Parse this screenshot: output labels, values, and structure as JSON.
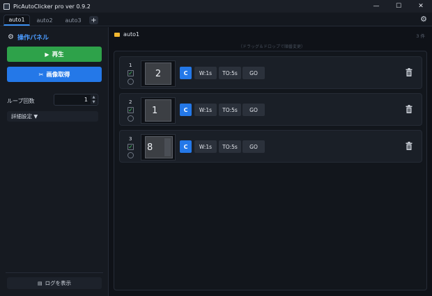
{
  "window": {
    "title": "PicAutoClicker pro ver 0.9.2",
    "controls": {
      "minimize": "—",
      "maximize": "☐",
      "close": "✕"
    }
  },
  "tabs": [
    {
      "label": "auto1",
      "active": true
    },
    {
      "label": "auto2",
      "active": false
    },
    {
      "label": "auto3",
      "active": false
    }
  ],
  "tab_add_label": "+",
  "left_panel": {
    "title": "操作パネル",
    "play_label": "再生",
    "capture_label": "画像取得",
    "loop_label": "ループ回数",
    "loop_value": "1",
    "advanced_label": "詳細設定 ▼",
    "log_label": "ログを表示"
  },
  "main": {
    "title": "auto1",
    "count": "3 件",
    "hint": "（ドラッグ＆ドロップで順番変更）",
    "rows": [
      {
        "index": "1",
        "checked": true,
        "thumb_text": "2",
        "c_label": "C",
        "wait": "W:1s",
        "timeout": "TO:5s",
        "go": "GO"
      },
      {
        "index": "2",
        "checked": true,
        "thumb_text": "1",
        "c_label": "C",
        "wait": "W:1s",
        "timeout": "TO:5s",
        "go": "GO"
      },
      {
        "index": "3",
        "checked": true,
        "thumb_text": "8",
        "c_label": "C",
        "wait": "W:1s",
        "timeout": "TO:5s",
        "go": "GO"
      }
    ]
  },
  "colors": {
    "accent": "#2478e8",
    "play": "#2ea24a",
    "check": "#41c75a",
    "folder": "#f2b730"
  }
}
